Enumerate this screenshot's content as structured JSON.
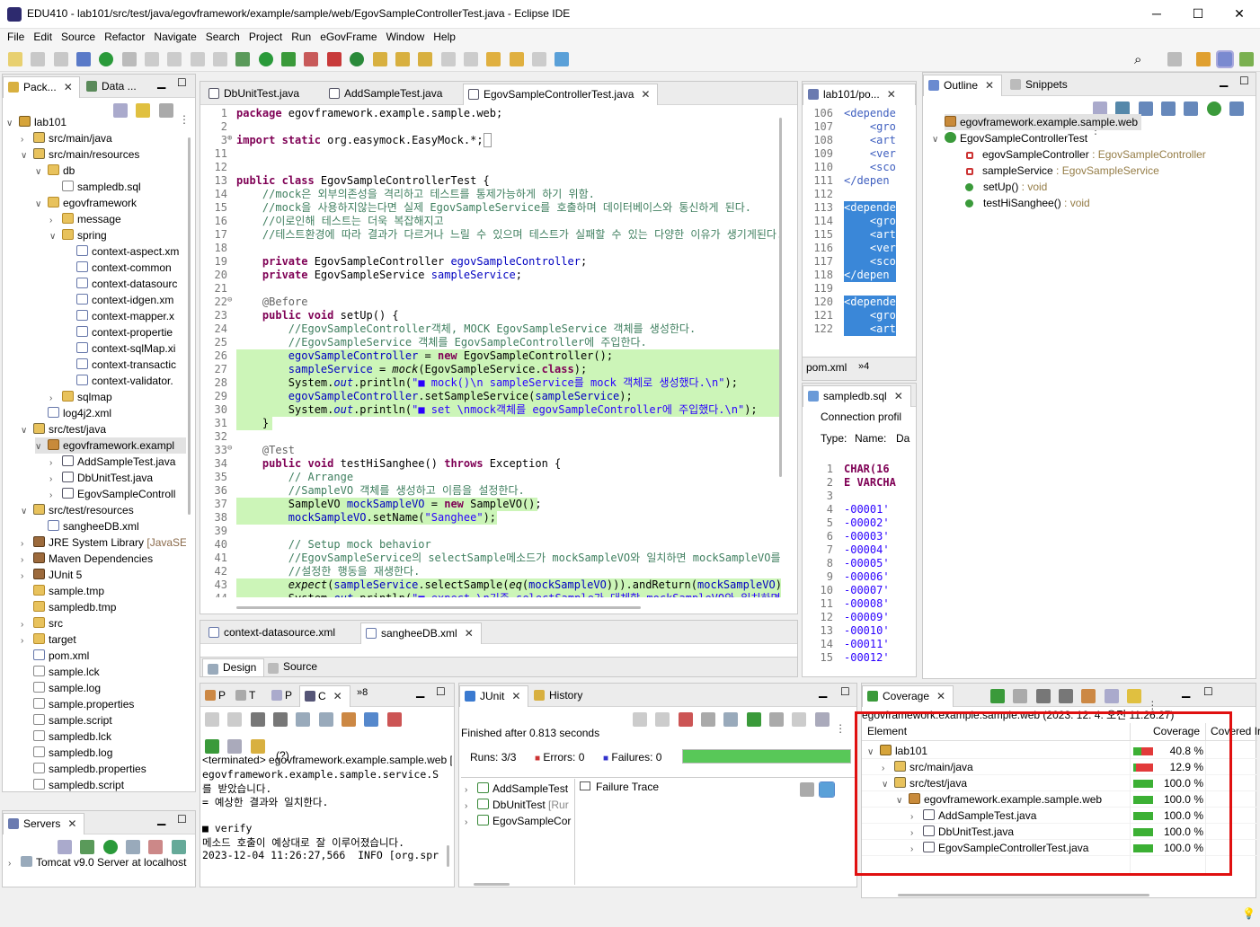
{
  "window": {
    "title": "EDU410 - lab101/src/test/java/egovframework/example/sample/web/EgovSampleControllerTest.java - Eclipse IDE",
    "minimize": "─",
    "maximize": "☐",
    "close": "✕"
  },
  "menu": [
    "File",
    "Edit",
    "Source",
    "Refactor",
    "Navigate",
    "Search",
    "Project",
    "Run",
    "eGovFrame",
    "Window",
    "Help"
  ],
  "left_tabs": {
    "package": "Pack...",
    "data": "Data ..."
  },
  "project_tree": [
    {
      "depth": 0,
      "tw": "∨",
      "icon": "ic-proj",
      "label": "lab101"
    },
    {
      "depth": 1,
      "tw": "›",
      "icon": "ic-src",
      "label": "src/main/java"
    },
    {
      "depth": 1,
      "tw": "∨",
      "icon": "ic-src",
      "label": "src/main/resources"
    },
    {
      "depth": 2,
      "tw": "∨",
      "icon": "ic-folder",
      "label": "db"
    },
    {
      "depth": 3,
      "tw": "",
      "icon": "ic-file",
      "label": "sampledb.sql"
    },
    {
      "depth": 2,
      "tw": "∨",
      "icon": "ic-folder",
      "label": "egovframework"
    },
    {
      "depth": 3,
      "tw": "›",
      "icon": "ic-folder",
      "label": "message"
    },
    {
      "depth": 3,
      "tw": "∨",
      "icon": "ic-folder",
      "label": "spring"
    },
    {
      "depth": 4,
      "tw": "",
      "icon": "ic-xml",
      "label": "context-aspect.xm"
    },
    {
      "depth": 4,
      "tw": "",
      "icon": "ic-xml",
      "label": "context-common"
    },
    {
      "depth": 4,
      "tw": "",
      "icon": "ic-xml",
      "label": "context-datasourc"
    },
    {
      "depth": 4,
      "tw": "",
      "icon": "ic-xml",
      "label": "context-idgen.xm"
    },
    {
      "depth": 4,
      "tw": "",
      "icon": "ic-xml",
      "label": "context-mapper.x"
    },
    {
      "depth": 4,
      "tw": "",
      "icon": "ic-xml",
      "label": "context-propertie"
    },
    {
      "depth": 4,
      "tw": "",
      "icon": "ic-xml",
      "label": "context-sqlMap.xi"
    },
    {
      "depth": 4,
      "tw": "",
      "icon": "ic-xml",
      "label": "context-transactic"
    },
    {
      "depth": 4,
      "tw": "",
      "icon": "ic-xml",
      "label": "context-validator."
    },
    {
      "depth": 3,
      "tw": "›",
      "icon": "ic-folder",
      "label": "sqlmap"
    },
    {
      "depth": 2,
      "tw": "",
      "icon": "ic-xml",
      "label": "log4j2.xml"
    },
    {
      "depth": 1,
      "tw": "∨",
      "icon": "ic-src",
      "label": "src/test/java"
    },
    {
      "depth": 2,
      "tw": "∨",
      "icon": "ic-pkg",
      "label": "egovframework.exampl",
      "selected": true
    },
    {
      "depth": 3,
      "tw": "›",
      "icon": "ic-java",
      "label": "AddSampleTest.java"
    },
    {
      "depth": 3,
      "tw": "›",
      "icon": "ic-java",
      "label": "DbUnitTest.java"
    },
    {
      "depth": 3,
      "tw": "›",
      "icon": "ic-java",
      "label": "EgovSampleControll"
    },
    {
      "depth": 1,
      "tw": "∨",
      "icon": "ic-src",
      "label": "src/test/resources"
    },
    {
      "depth": 2,
      "tw": "",
      "icon": "ic-xml",
      "label": "sangheeDB.xml"
    },
    {
      "depth": 1,
      "tw": "›",
      "icon": "ic-lib",
      "label": "JRE System Library",
      "suffix": " [JavaSE"
    },
    {
      "depth": 1,
      "tw": "›",
      "icon": "ic-lib",
      "label": "Maven Dependencies"
    },
    {
      "depth": 1,
      "tw": "›",
      "icon": "ic-lib",
      "label": "JUnit 5"
    },
    {
      "depth": 1,
      "tw": "",
      "icon": "ic-folder",
      "label": "sample.tmp"
    },
    {
      "depth": 1,
      "tw": "",
      "icon": "ic-folder",
      "label": "sampledb.tmp"
    },
    {
      "depth": 1,
      "tw": "›",
      "icon": "ic-folder",
      "label": "src"
    },
    {
      "depth": 1,
      "tw": "›",
      "icon": "ic-folder",
      "label": "target"
    },
    {
      "depth": 1,
      "tw": "",
      "icon": "ic-xml",
      "label": "pom.xml"
    },
    {
      "depth": 1,
      "tw": "",
      "icon": "ic-file",
      "label": "sample.lck"
    },
    {
      "depth": 1,
      "tw": "",
      "icon": "ic-file",
      "label": "sample.log"
    },
    {
      "depth": 1,
      "tw": "",
      "icon": "ic-file",
      "label": "sample.properties"
    },
    {
      "depth": 1,
      "tw": "",
      "icon": "ic-file",
      "label": "sample.script"
    },
    {
      "depth": 1,
      "tw": "",
      "icon": "ic-file",
      "label": "sampledb.lck"
    },
    {
      "depth": 1,
      "tw": "",
      "icon": "ic-file",
      "label": "sampledb.log"
    },
    {
      "depth": 1,
      "tw": "",
      "icon": "ic-file",
      "label": "sampledb.properties"
    },
    {
      "depth": 1,
      "tw": "",
      "icon": "ic-file",
      "label": "sampledb.script"
    }
  ],
  "servers": {
    "tab": "Servers",
    "item": "Tomcat v9.0 Server at localhost"
  },
  "editor": {
    "tabs": [
      "DbUnitTest.java",
      "AddSampleTest.java",
      "EgovSampleControllerTest.java"
    ],
    "lines": [
      {
        "n": "1",
        "html": "<span class='kw'>package</span> egovframework.example.sample.web;"
      },
      {
        "n": "2",
        "html": ""
      },
      {
        "n": "3",
        "html": "<span class='kw'>import static</span> org.easymock.EasyMock.*;<span style='border:1px solid #999'>&nbsp;</span>"
      },
      {
        "n": "11",
        "html": ""
      },
      {
        "n": "12",
        "html": ""
      },
      {
        "n": "13",
        "html": "<span class='kw'>public class</span> EgovSampleControllerTest {"
      },
      {
        "n": "14",
        "html": "    <span class='cm'>//mock은 외부의존성을 격리하고 테스트를 통제가능하게 하기 위함.</span>"
      },
      {
        "n": "15",
        "html": "    <span class='cm'>//mock을 사용하지않는다면 실제 EgovSampleService를 호출하며 데이터베이스와 통신하게 된다.</span>"
      },
      {
        "n": "16",
        "html": "    <span class='cm'>//이로인해 테스트는 더욱 복잡해지고</span>"
      },
      {
        "n": "17",
        "html": "    <span class='cm'>//테스트환경에 따라 결과가 다르거나 느릴 수 있으며 테스트가 실패할 수 있는 다양한 이유가 생기게된다.</span>"
      },
      {
        "n": "18",
        "html": ""
      },
      {
        "n": "19",
        "html": "    <span class='kw'>private</span> EgovSampleController <span class='fd'>egovSampleController</span>;"
      },
      {
        "n": "20",
        "html": "    <span class='kw'>private</span> EgovSampleService <span class='fd'>sampleService</span>;"
      },
      {
        "n": "21",
        "html": ""
      },
      {
        "n": "22",
        "html": "    <span class='an'>@Before</span>"
      },
      {
        "n": "23",
        "html": "    <span class='kw'>public void</span> setUp() {"
      },
      {
        "n": "24",
        "html": "        <span class='cm'>//EgovSampleController객체, MOCK EgovSampleService 객체를 생성한다.</span>"
      },
      {
        "n": "25",
        "html": "        <span class='cm'>//EgovSampleService 객체를 EgovSampleController에 주입한다.</span>"
      },
      {
        "n": "26",
        "html": "        <span class='fd'>egovSampleController</span> = <span class='kw'>new</span> EgovSampleController();",
        "hl": true
      },
      {
        "n": "27",
        "html": "        <span class='fd'>sampleService</span> = <span class='it'>mock</span>(EgovSampleService.<span class='kw'>class</span>);",
        "hl": true
      },
      {
        "n": "28",
        "html": "        System.<span class='fd it'>out</span>.println(<span class='st'>\"■ mock()\\n sampleService를 mock 객체로 생성했다.\\n\"</span>);",
        "hl": true
      },
      {
        "n": "29",
        "html": "        <span class='fd'>egovSampleController</span>.setSampleService(<span class='fd'>sampleService</span>);",
        "hl": true
      },
      {
        "n": "30",
        "html": "        System.<span class='fd it'>out</span>.println(<span class='st'>\"■ set \\nmock객체를 egovSampleController에 주입했다.\\n\"</span>);",
        "hl": true
      },
      {
        "n": "31",
        "html": "    }",
        "hl": true,
        "hlw": 40
      },
      {
        "n": "32",
        "html": ""
      },
      {
        "n": "33",
        "html": "    <span class='an'>@Test</span>"
      },
      {
        "n": "34",
        "html": "    <span class='kw'>public void</span> testHiSanghee() <span class='kw'>throws</span> Exception {"
      },
      {
        "n": "35",
        "html": "        <span class='cm'>// Arrange</span>"
      },
      {
        "n": "36",
        "html": "        <span class='cm'>//SampleVO 객체를 생성하고 이름을 설정한다.</span>"
      },
      {
        "n": "37",
        "html": "        SampleVO <span class='fd'>mockSampleVO</span> = <span class='kw'>new</span> SampleVO();",
        "hl": true,
        "hlw": 335
      },
      {
        "n": "38",
        "html": "        <span class='fd'>mockSampleVO</span>.setName(<span class='st'>\"Sanghee\"</span>);",
        "hl": true,
        "hlw": 290
      },
      {
        "n": "39",
        "html": ""
      },
      {
        "n": "40",
        "html": "        <span class='cm'>// Setup mock behavior</span>"
      },
      {
        "n": "41",
        "html": "        <span class='cm'>//EgovSampleService의 selectSample메소드가 mockSampleVO와 일치하면 mockSampleVO를 빈</span>"
      },
      {
        "n": "42",
        "html": "        <span class='cm'>//설정한 행동을 재생한다.</span>"
      },
      {
        "n": "43",
        "html": "        <span class='it'>expect</span>(<span class='fd'>sampleService</span>.selectSample(<span class='it'>eq</span>(<span class='fd'>mockSampleVO</span>))).andReturn(<span class='fd'>mockSampleVO</span>);",
        "hl": true
      },
      {
        "n": "44",
        "html": "        System.<span class='fd it'>out</span>.println(<span class='st'>\"■ expect \\n기존 selectSample가 대체할 mockSampleVO와 일치하면</span>",
        "hl": true
      }
    ],
    "bottom_tabs": [
      "context-datasource.xml",
      "sangheeDB.xml"
    ],
    "design_tabs": {
      "design": "Design",
      "source": "Source"
    }
  },
  "pom": {
    "tab": "lab101/po...",
    "lines": [
      {
        "n": "106",
        "t": "<depende",
        "fold": true
      },
      {
        "n": "107",
        "t": "    <gro"
      },
      {
        "n": "108",
        "t": "    <art"
      },
      {
        "n": "109",
        "t": "    <ver"
      },
      {
        "n": "110",
        "t": "    <sco"
      },
      {
        "n": "111",
        "t": "</depen"
      },
      {
        "n": "112",
        "t": ""
      },
      {
        "n": "113",
        "t": "<depende",
        "sel": true,
        "fold": true
      },
      {
        "n": "114",
        "t": "    <gro",
        "sel": true
      },
      {
        "n": "115",
        "t": "    <art",
        "sel": true
      },
      {
        "n": "116",
        "t": "    <ver",
        "sel": true
      },
      {
        "n": "117",
        "t": "    <sco",
        "sel": true
      },
      {
        "n": "118",
        "t": "</depen",
        "sel": true
      },
      {
        "n": "119",
        "t": ""
      },
      {
        "n": "120",
        "t": "<depende",
        "sel": true,
        "fold": true
      },
      {
        "n": "121",
        "t": "    <gro",
        "sel": true
      },
      {
        "n": "122",
        "t": "    <art",
        "sel": true
      }
    ],
    "bottom_tab": "pom.xml",
    "overflow": "»4"
  },
  "sql": {
    "tab": "sampledb.sql",
    "conn_label": "Connection profil",
    "type_label": "Type:",
    "name_label": "Name:",
    "db_label": "Da",
    "lines": [
      {
        "n": "1",
        "t": "CHAR(16"
      },
      {
        "n": "2",
        "t": "E VARCHA"
      },
      {
        "n": "3",
        "t": ""
      },
      {
        "n": "4",
        "t": "-00001'"
      },
      {
        "n": "5",
        "t": "-00002'"
      },
      {
        "n": "6",
        "t": "-00003'"
      },
      {
        "n": "7",
        "t": "-00004'"
      },
      {
        "n": "8",
        "t": "-00005'"
      },
      {
        "n": "9",
        "t": "-00006'"
      },
      {
        "n": "10",
        "t": "-00007'"
      },
      {
        "n": "11",
        "t": "-00008'"
      },
      {
        "n": "12",
        "t": "-00009'"
      },
      {
        "n": "13",
        "t": "-00010'"
      },
      {
        "n": "14",
        "t": "-00011'"
      },
      {
        "n": "15",
        "t": "-00012'"
      }
    ]
  },
  "outline": {
    "tab": "Outline",
    "snippets_tab": "Snippets",
    "package": "egovframework.example.sample.web",
    "class": "EgovSampleControllerTest",
    "members": [
      {
        "name": "egovSampleController",
        "type": " : EgovSampleController",
        "kind": "field"
      },
      {
        "name": "sampleService",
        "type": " : EgovSampleService",
        "kind": "field"
      },
      {
        "name": "setUp()",
        "type": " : void",
        "kind": "method"
      },
      {
        "name": "testHiSanghee()",
        "type": " : void",
        "kind": "method"
      }
    ]
  },
  "console": {
    "tabs": [
      "P",
      "T",
      "P",
      "C"
    ],
    "overflow": "»8",
    "help": "(?)",
    "terminated": "<terminated> egovframework.example.sample.web [",
    "lines": [
      "egovframework.example.sample.service.S",
      "를 받았습니다.",
      "= 예상한 결과와 일치한다.",
      "",
      "■ verify",
      "메소드 호출이 예상대로 잘 이루어졌습니다.",
      "2023-12-04 11:26:27,566  INFO [org.spr"
    ]
  },
  "junit": {
    "tab": "JUnit",
    "history_tab": "History",
    "finished": "Finished after 0.813 seconds",
    "runs_label": "Runs:",
    "runs": "3/3",
    "errors_label": "Errors:",
    "errors": "0",
    "failures_label": "Failures:",
    "failures": "0",
    "progress": 1.0,
    "failure_trace": "Failure Trace",
    "tests": [
      {
        "label": "AddSampleTest",
        "suffix": ""
      },
      {
        "label": "DbUnitTest",
        "suffix": " [Rur"
      },
      {
        "label": "EgovSampleCor",
        "suffix": ""
      }
    ]
  },
  "coverage": {
    "tab": "Coverage",
    "header": "egovframework.example.sample.web (2023. 12. 4. 오전 11:26:27)",
    "col_element": "Element",
    "col_coverage": "Coverage",
    "col_covered": "Covered Ir",
    "rows": [
      {
        "depth": 0,
        "tw": "∨",
        "label": "lab101",
        "pct": "40.8 %",
        "value": 40.8,
        "icon": "ic-proj"
      },
      {
        "depth": 1,
        "tw": "›",
        "label": "src/main/java",
        "pct": "12.9 %",
        "value": 12.9,
        "icon": "ic-src"
      },
      {
        "depth": 1,
        "tw": "∨",
        "label": "src/test/java",
        "pct": "100.0 %",
        "value": 100.0,
        "icon": "ic-src"
      },
      {
        "depth": 2,
        "tw": "∨",
        "label": "egovframework.example.sample.web",
        "pct": "100.0 %",
        "value": 100.0,
        "icon": "ic-pkg"
      },
      {
        "depth": 3,
        "tw": "›",
        "label": "AddSampleTest.java",
        "pct": "100.0 %",
        "value": 100.0,
        "icon": "ic-java"
      },
      {
        "depth": 3,
        "tw": "›",
        "label": "DbUnitTest.java",
        "pct": "100.0 %",
        "value": 100.0,
        "icon": "ic-java"
      },
      {
        "depth": 3,
        "tw": "›",
        "label": "EgovSampleControllerTest.java",
        "pct": "100.0 %",
        "value": 100.0,
        "icon": "ic-java"
      }
    ]
  },
  "colors": {
    "covered": "#3cb034",
    "missed": "#e23a3a",
    "highlight_box": "#e01010",
    "junit_progress": "#58c858"
  }
}
